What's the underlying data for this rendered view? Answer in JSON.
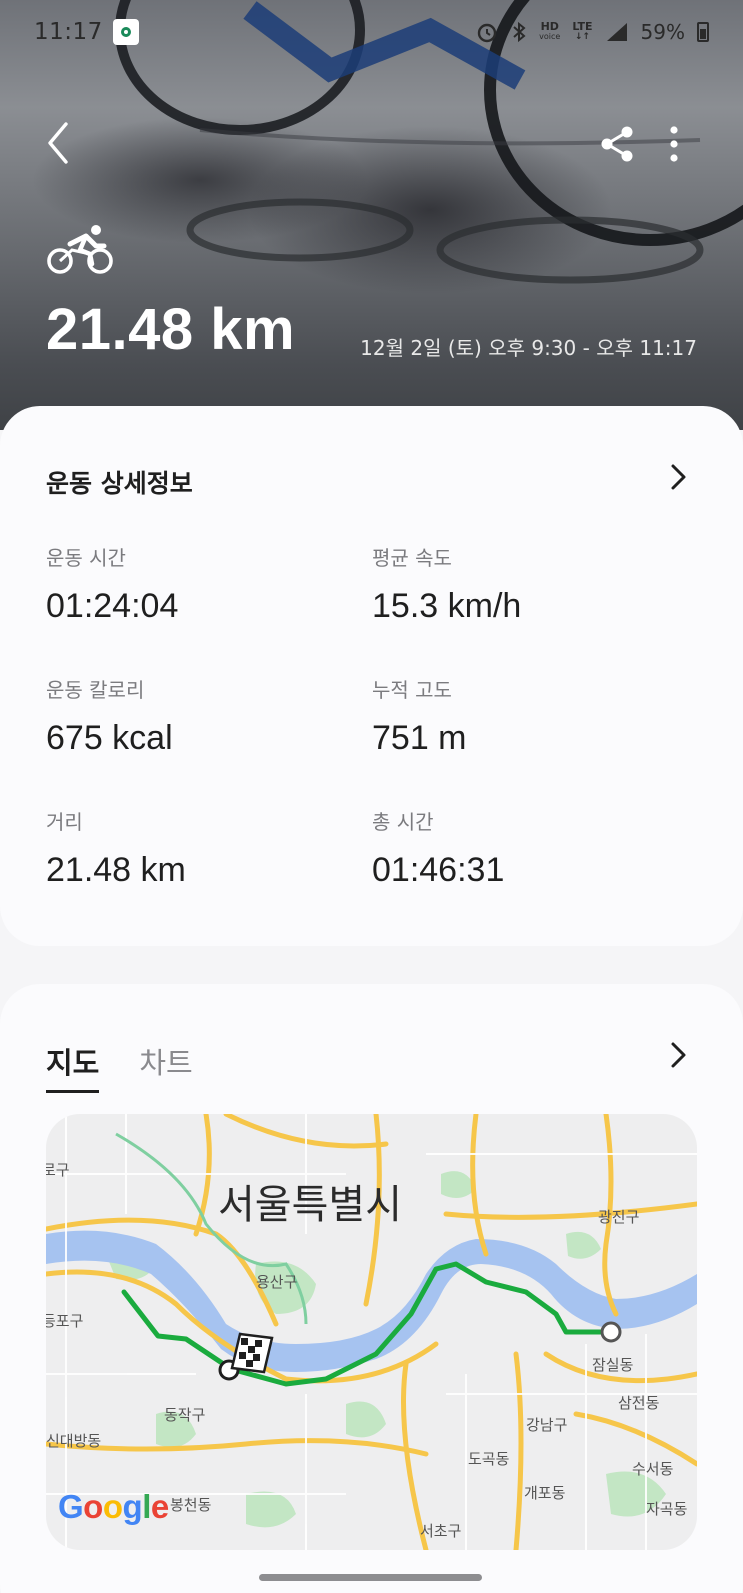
{
  "status_bar": {
    "time": "11:17",
    "hd_label": "HD",
    "voice_label": "voice",
    "lte_label": "LTE",
    "battery": "59%"
  },
  "header": {
    "distance": "21.48 km",
    "datetime": "12월 2일 (토) 오후 9:30 - 오후 11:17",
    "activity_icon": "bicycle-icon"
  },
  "details": {
    "title": "운동 상세정보",
    "stats": [
      {
        "label": "운동 시간",
        "value": "01:24:04"
      },
      {
        "label": "평균 속도",
        "value": "15.3 km/h"
      },
      {
        "label": "운동 칼로리",
        "value": "675 kcal"
      },
      {
        "label": "누적 고도",
        "value": "751 m"
      },
      {
        "label": "거리",
        "value": "21.48 km"
      },
      {
        "label": "총 시간",
        "value": "01:46:31"
      }
    ]
  },
  "map_card": {
    "tabs": [
      {
        "label": "지도",
        "active": true
      },
      {
        "label": "차트",
        "active": false
      }
    ],
    "map": {
      "city_label": "서울특별시",
      "place_labels": [
        "광진구",
        "용산구",
        "잠실동",
        "삼전동",
        "강남구",
        "동작구",
        "도곡동",
        "수서동",
        "개포동",
        "신대방동",
        "봉천동",
        "서초구",
        "자곡동",
        "등포구",
        "로구"
      ],
      "attribution": "Google"
    }
  },
  "colors": {
    "route": "#1aab3e",
    "river": "#a6c3f0",
    "road": "#f6c64a",
    "park": "#c3e6c4",
    "accent_text": "#1f1f1f"
  }
}
